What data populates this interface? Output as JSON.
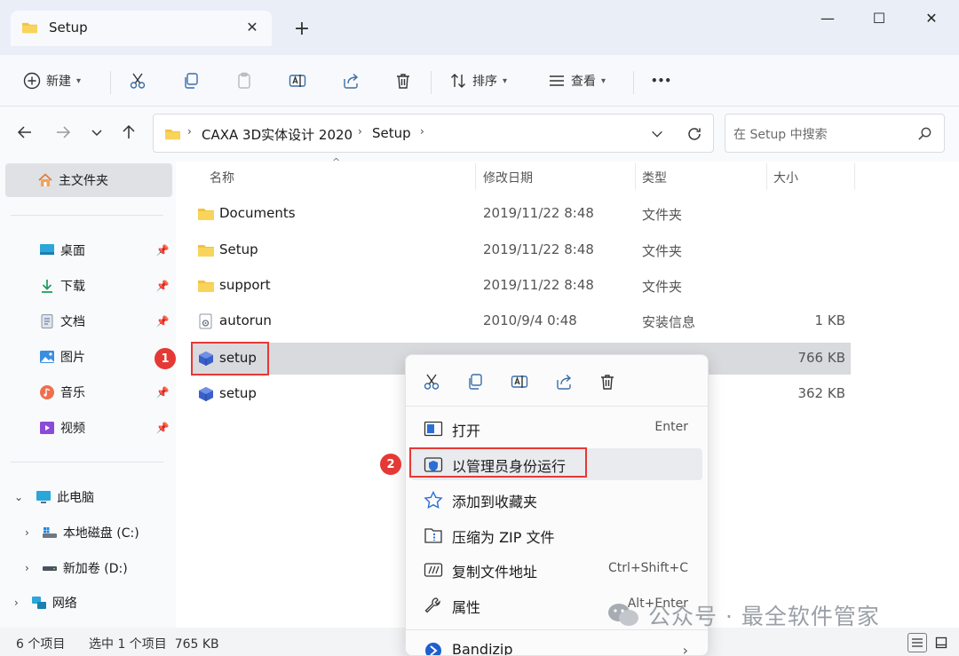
{
  "window": {
    "tab_title": "Setup",
    "tab_close_glyph": "✕",
    "new_tab_glyph": "+",
    "minimize_glyph": "—",
    "maximize_glyph": "☐",
    "close_glyph": "✕"
  },
  "commandbar": {
    "new_label": "新建",
    "sort_label": "排序",
    "view_label": "查看",
    "more_label": "•••",
    "icons": [
      "cut-icon",
      "copy-icon",
      "paste-icon",
      "rename-icon",
      "share-icon",
      "delete-icon"
    ]
  },
  "address": {
    "segments": [
      "CAXA 3D实体设计 2020",
      "Setup"
    ],
    "search_placeholder": "在 Setup 中搜索"
  },
  "sidebar": {
    "home": "主文件夹",
    "pinned": [
      {
        "label": "桌面",
        "icon": "desktop-icon"
      },
      {
        "label": "下载",
        "icon": "download-icon"
      },
      {
        "label": "文档",
        "icon": "document-icon"
      },
      {
        "label": "图片",
        "icon": "pictures-icon"
      },
      {
        "label": "音乐",
        "icon": "music-icon"
      },
      {
        "label": "视频",
        "icon": "video-icon"
      }
    ],
    "this_pc": "此电脑",
    "drives": [
      "本地磁盘 (C:)",
      "新加卷 (D:)"
    ],
    "network": "网络"
  },
  "columns": {
    "name": "名称",
    "modified": "修改日期",
    "type": "类型",
    "size": "大小"
  },
  "files": [
    {
      "name": "Documents",
      "modified": "2019/11/22 8:48",
      "type": "文件夹",
      "size": "",
      "icon": "folder-icon"
    },
    {
      "name": "Setup",
      "modified": "2019/11/22 8:48",
      "type": "文件夹",
      "size": "",
      "icon": "folder-icon"
    },
    {
      "name": "support",
      "modified": "2019/11/22 8:48",
      "type": "文件夹",
      "size": "",
      "icon": "folder-icon"
    },
    {
      "name": "autorun",
      "modified": "2010/9/4 0:48",
      "type": "安装信息",
      "size": "1 KB",
      "icon": "setup-info-icon"
    },
    {
      "name": "setup",
      "modified": "",
      "type": "",
      "size": "766 KB",
      "icon": "installer-icon",
      "selected": true
    },
    {
      "name": "setup",
      "modified": "",
      "type": "",
      "size": "362 KB",
      "icon": "installer-icon"
    }
  ],
  "status": {
    "count": "6 个项目",
    "selection": "选中 1 个项目  765 KB"
  },
  "context_menu": {
    "quick_actions": [
      "cut-icon",
      "copy-icon",
      "rename-icon",
      "share-icon",
      "delete-icon"
    ],
    "items": [
      {
        "label": "打开",
        "shortcut": "Enter",
        "icon": "open-icon"
      },
      {
        "label": "以管理员身份运行",
        "shortcut": "",
        "icon": "shield-icon"
      },
      {
        "label": "添加到收藏夹",
        "shortcut": "",
        "icon": "star-icon"
      },
      {
        "label": "压缩为 ZIP 文件",
        "shortcut": "",
        "icon": "zip-icon"
      },
      {
        "label": "复制文件地址",
        "shortcut": "Ctrl+Shift+C",
        "icon": "copy-path-icon"
      },
      {
        "label": "属性",
        "shortcut": "Alt+Enter",
        "icon": "properties-icon"
      },
      {
        "label": "Bandizip",
        "shortcut": "",
        "icon": "bandizip-icon"
      }
    ]
  },
  "annotations": {
    "badge1": "1",
    "badge2": "2"
  },
  "watermark": "公众号 · 最全软件管家",
  "colors": {
    "accent_red": "#e53935",
    "folder_yellow": "#f4c23f",
    "selection_gray": "#d9dadd"
  }
}
